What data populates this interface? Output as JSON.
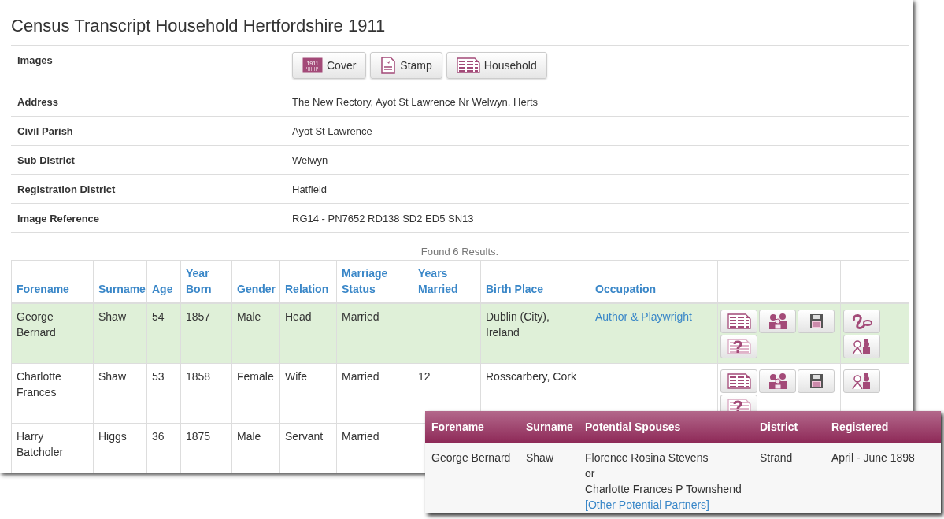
{
  "title": "Census Transcript Household Hertfordshire 1911",
  "details": [
    {
      "label": "Images",
      "kind": "buttons",
      "buttons": [
        {
          "kind": "cover",
          "label": "Cover",
          "icon_text": "1911"
        },
        {
          "kind": "stamp",
          "label": "Stamp"
        },
        {
          "kind": "household",
          "label": "Household"
        }
      ]
    },
    {
      "label": "Address",
      "kind": "text",
      "value": "The New Rectory, Ayot St Lawrence Nr Welwyn, Herts"
    },
    {
      "label": "Civil Parish",
      "kind": "text",
      "value": "Ayot St Lawrence"
    },
    {
      "label": "Sub District",
      "kind": "text",
      "value": "Welwyn"
    },
    {
      "label": "Registration District",
      "kind": "text",
      "value": "Hatfield"
    },
    {
      "label": "Image Reference",
      "kind": "text",
      "value": "RG14 - PN7652 RD138 SD2 ED5 SN13"
    }
  ],
  "results_count": "Found 6 Results.",
  "table": {
    "columns": [
      "Forename",
      "Surname",
      "Age",
      "Year Born",
      "Gender",
      "Relation",
      "Marriage Status",
      "Years Married",
      "Birth Place",
      "Occupation"
    ],
    "rows": [
      {
        "selected": true,
        "cells": [
          "George Bernard",
          "Shaw",
          "54",
          "1857",
          "Male",
          "Head",
          "Married",
          "",
          "Dublin (City), Ireland"
        ],
        "occupation": {
          "text": "Author & Playwright",
          "link": true
        },
        "actions": [
          {
            "kind": "household"
          },
          {
            "kind": "family"
          },
          {
            "kind": "save"
          },
          {
            "kind": "query"
          }
        ],
        "extras": [
          {
            "kind": "link"
          },
          {
            "kind": "couple"
          }
        ]
      },
      {
        "selected": false,
        "cells": [
          "Charlotte Frances",
          "Shaw",
          "53",
          "1858",
          "Female",
          "Wife",
          "Married",
          "12",
          "Rosscarbery, Cork"
        ],
        "actions": [
          {
            "kind": "household"
          },
          {
            "kind": "family"
          },
          {
            "kind": "save"
          },
          {
            "kind": "query"
          }
        ],
        "extras": [
          {
            "kind": "couple"
          }
        ]
      },
      {
        "selected": false,
        "cells": [
          "Harry Batcholer",
          "Higgs",
          "36",
          "1875",
          "Male",
          "Servant",
          "Married",
          "",
          ""
        ]
      }
    ]
  },
  "popup": {
    "columns": [
      "Forename",
      "Surname",
      "Potential Spouses",
      "District",
      "Registered"
    ],
    "forename": "George Bernard",
    "surname": "Shaw",
    "spouses": [
      "Florence Rosina Stevens",
      "or",
      "Charlotte Frances P Townshend"
    ],
    "other_link": "[Other Potential Partners]",
    "district": "Strand",
    "registered": "April - June 1898"
  }
}
